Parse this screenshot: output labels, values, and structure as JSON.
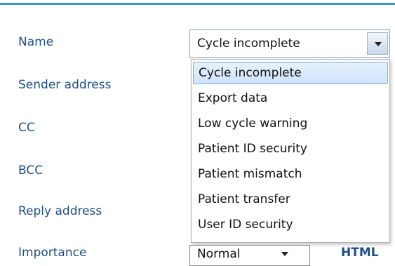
{
  "form": {
    "labels": {
      "name": "Name",
      "sender_address": "Sender address",
      "cc": "CC",
      "bcc": "BCC",
      "reply_address": "Reply address",
      "importance": "Importance"
    },
    "name_select": {
      "value": "Cycle incomplete",
      "options": [
        "Cycle incomplete",
        "Export data",
        "Low cycle warning",
        "Patient ID security",
        "Patient mismatch",
        "Patient transfer",
        "User ID security"
      ]
    },
    "importance_select": {
      "value": "Normal"
    },
    "format_link": "HTML"
  },
  "colors": {
    "accent": "#3d8fd6",
    "label_text": "#1e4f86",
    "selected_bg": "#cfe3fa"
  }
}
